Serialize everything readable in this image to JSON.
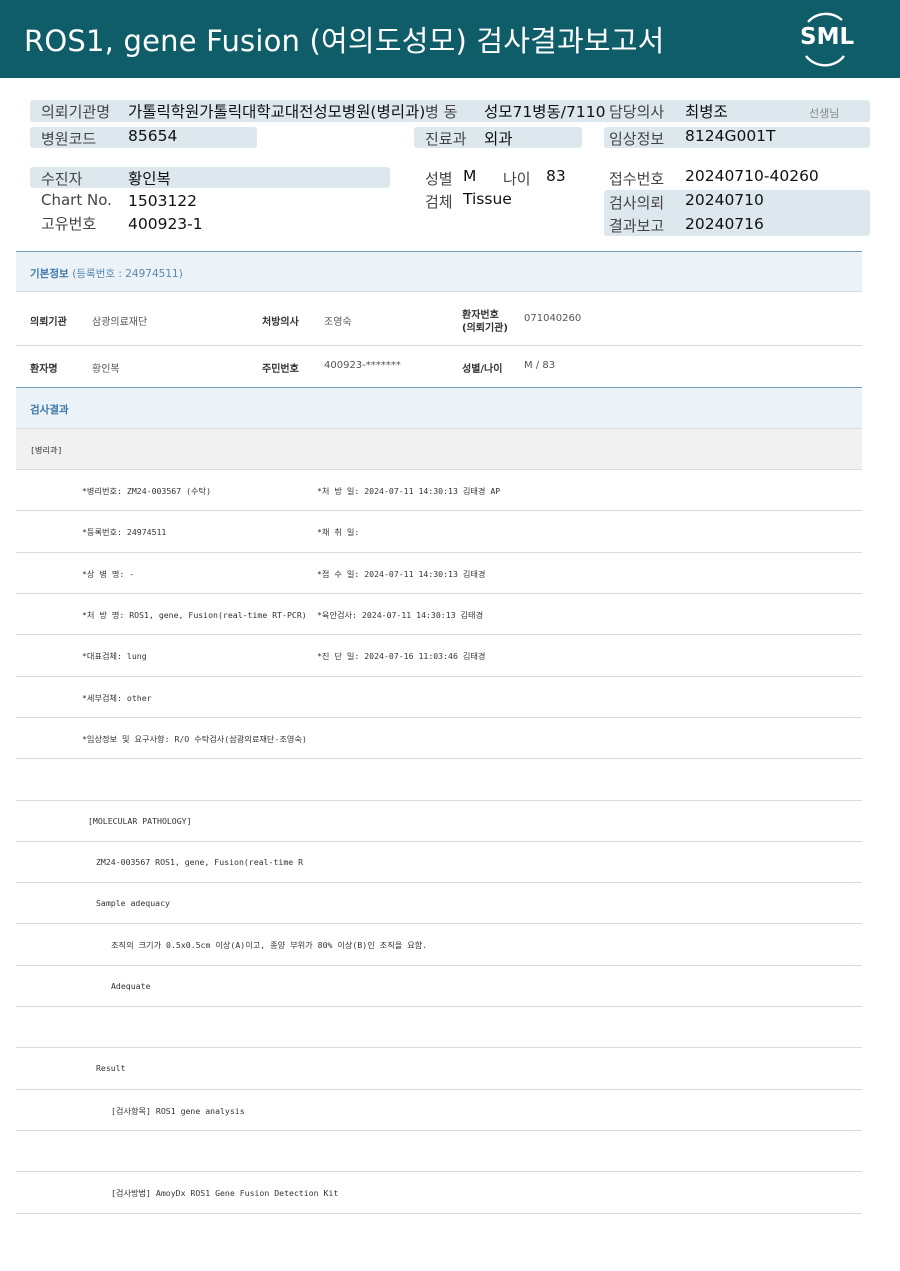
{
  "header": {
    "title": "ROS1, gene Fusion (여의도성모) 검사결과보고서",
    "logo_text": "SML"
  },
  "patient_header": {
    "institution_label": "의뢰기관명",
    "institution_value": "가톨릭학원가톨릭대학교대전성모병원(병리과)",
    "ward_label": "병  동",
    "ward_value": "성모71병동/7110",
    "doctor_label": "담당의사",
    "doctor_value": "최병조",
    "doctor_suffix": "선생님",
    "hospital_code_label": "병원코드",
    "hospital_code_value": "85654",
    "dept_label": "진료과",
    "dept_value": "외과",
    "clinical_label": "임상정보",
    "clinical_value": "8124G001T",
    "patient_label": "수진자",
    "patient_value": "황인복",
    "sex_label": "성별",
    "sex_value": "M",
    "age_label": "나이",
    "age_value": "83",
    "receipt_label": "접수번호",
    "receipt_value": "20240710-40260",
    "chart_label": "Chart No.",
    "chart_value": "1503122",
    "specimen_label": "검체",
    "specimen_value": "Tissue",
    "request_label": "검사의뢰",
    "request_value": "20240710",
    "unique_label": "고유번호",
    "unique_value": "400923-1",
    "report_label": "결과보고",
    "report_value": "20240716"
  },
  "basic_info": {
    "title": "기본정보",
    "reg_note": "(등록번호 : 24974511)",
    "institution_label": "의뢰기관",
    "institution_value": "삼광의료재단",
    "prescriber_label": "처방의사",
    "prescriber_value": "조영숙",
    "patient_no_label_1": "환자번호",
    "patient_no_label_2": "(의뢰기관)",
    "patient_no_value": "071040260",
    "name_label": "환자명",
    "name_value": "황인복",
    "rrn_label": "주민번호",
    "rrn_value": "400923-*******",
    "sex_age_label": "성별/나이",
    "sex_age_value": "M / 83"
  },
  "results": {
    "title": "검사결과",
    "subsection": "[병리과]",
    "lines": [
      {
        "left": "*병리번호: ZM24-003567 (수탁)",
        "right": "*처 방 일: 2024-07-11 14:30:13  김태경 AP"
      },
      {
        "left": "*등록번호: 24974511",
        "right": "*채 취 일:"
      },
      {
        "left": "*상 병 명: -",
        "right": "*접 수 일: 2024-07-11 14:30:13  김태경"
      },
      {
        "left": "*처 방 명: ROS1, gene, Fusion(real-time RT-PCR)",
        "right": "*육안검사: 2024-07-11 14:30:13  김태경"
      },
      {
        "left": "*대표검체: lung",
        "right": "*진 단 일: 2024-07-16 11:03:46  김태경"
      },
      {
        "left": "*세부검체: other",
        "right": ""
      },
      {
        "left": "*임상정보 및 요구사항: R/O 수탁검사(삼광의료재단-조영숙)",
        "right": ""
      }
    ],
    "molecular": [
      {
        "text": "[MOLECULAR PATHOLOGY]",
        "indent": 1
      },
      {
        "text": "ZM24-003567     ROS1, gene, Fusion(real-time R",
        "indent": 2
      },
      {
        "text": "Sample adequacy",
        "indent": 2
      },
      {
        "text": "조직의 크기가 0.5x0.5cm 이상(A)이고, 종양 부위가 80% 이상(B)인 조직을 요함.",
        "indent": 3
      },
      {
        "text": "Adequate",
        "indent": 3
      },
      {
        "text": "",
        "indent": 0
      },
      {
        "text": "Result",
        "indent": 2
      },
      {
        "text": "[검사항목] ROS1 gene analysis",
        "indent": 3
      },
      {
        "text": "",
        "indent": 0
      },
      {
        "text": "[검사방법] AmoyDx ROS1 Gene Fusion Detection Kit",
        "indent": 3
      }
    ]
  },
  "colors": {
    "header_bg": "#0f5d68",
    "band_bg": "#dde8ee",
    "section_title": "#3d78a8"
  }
}
